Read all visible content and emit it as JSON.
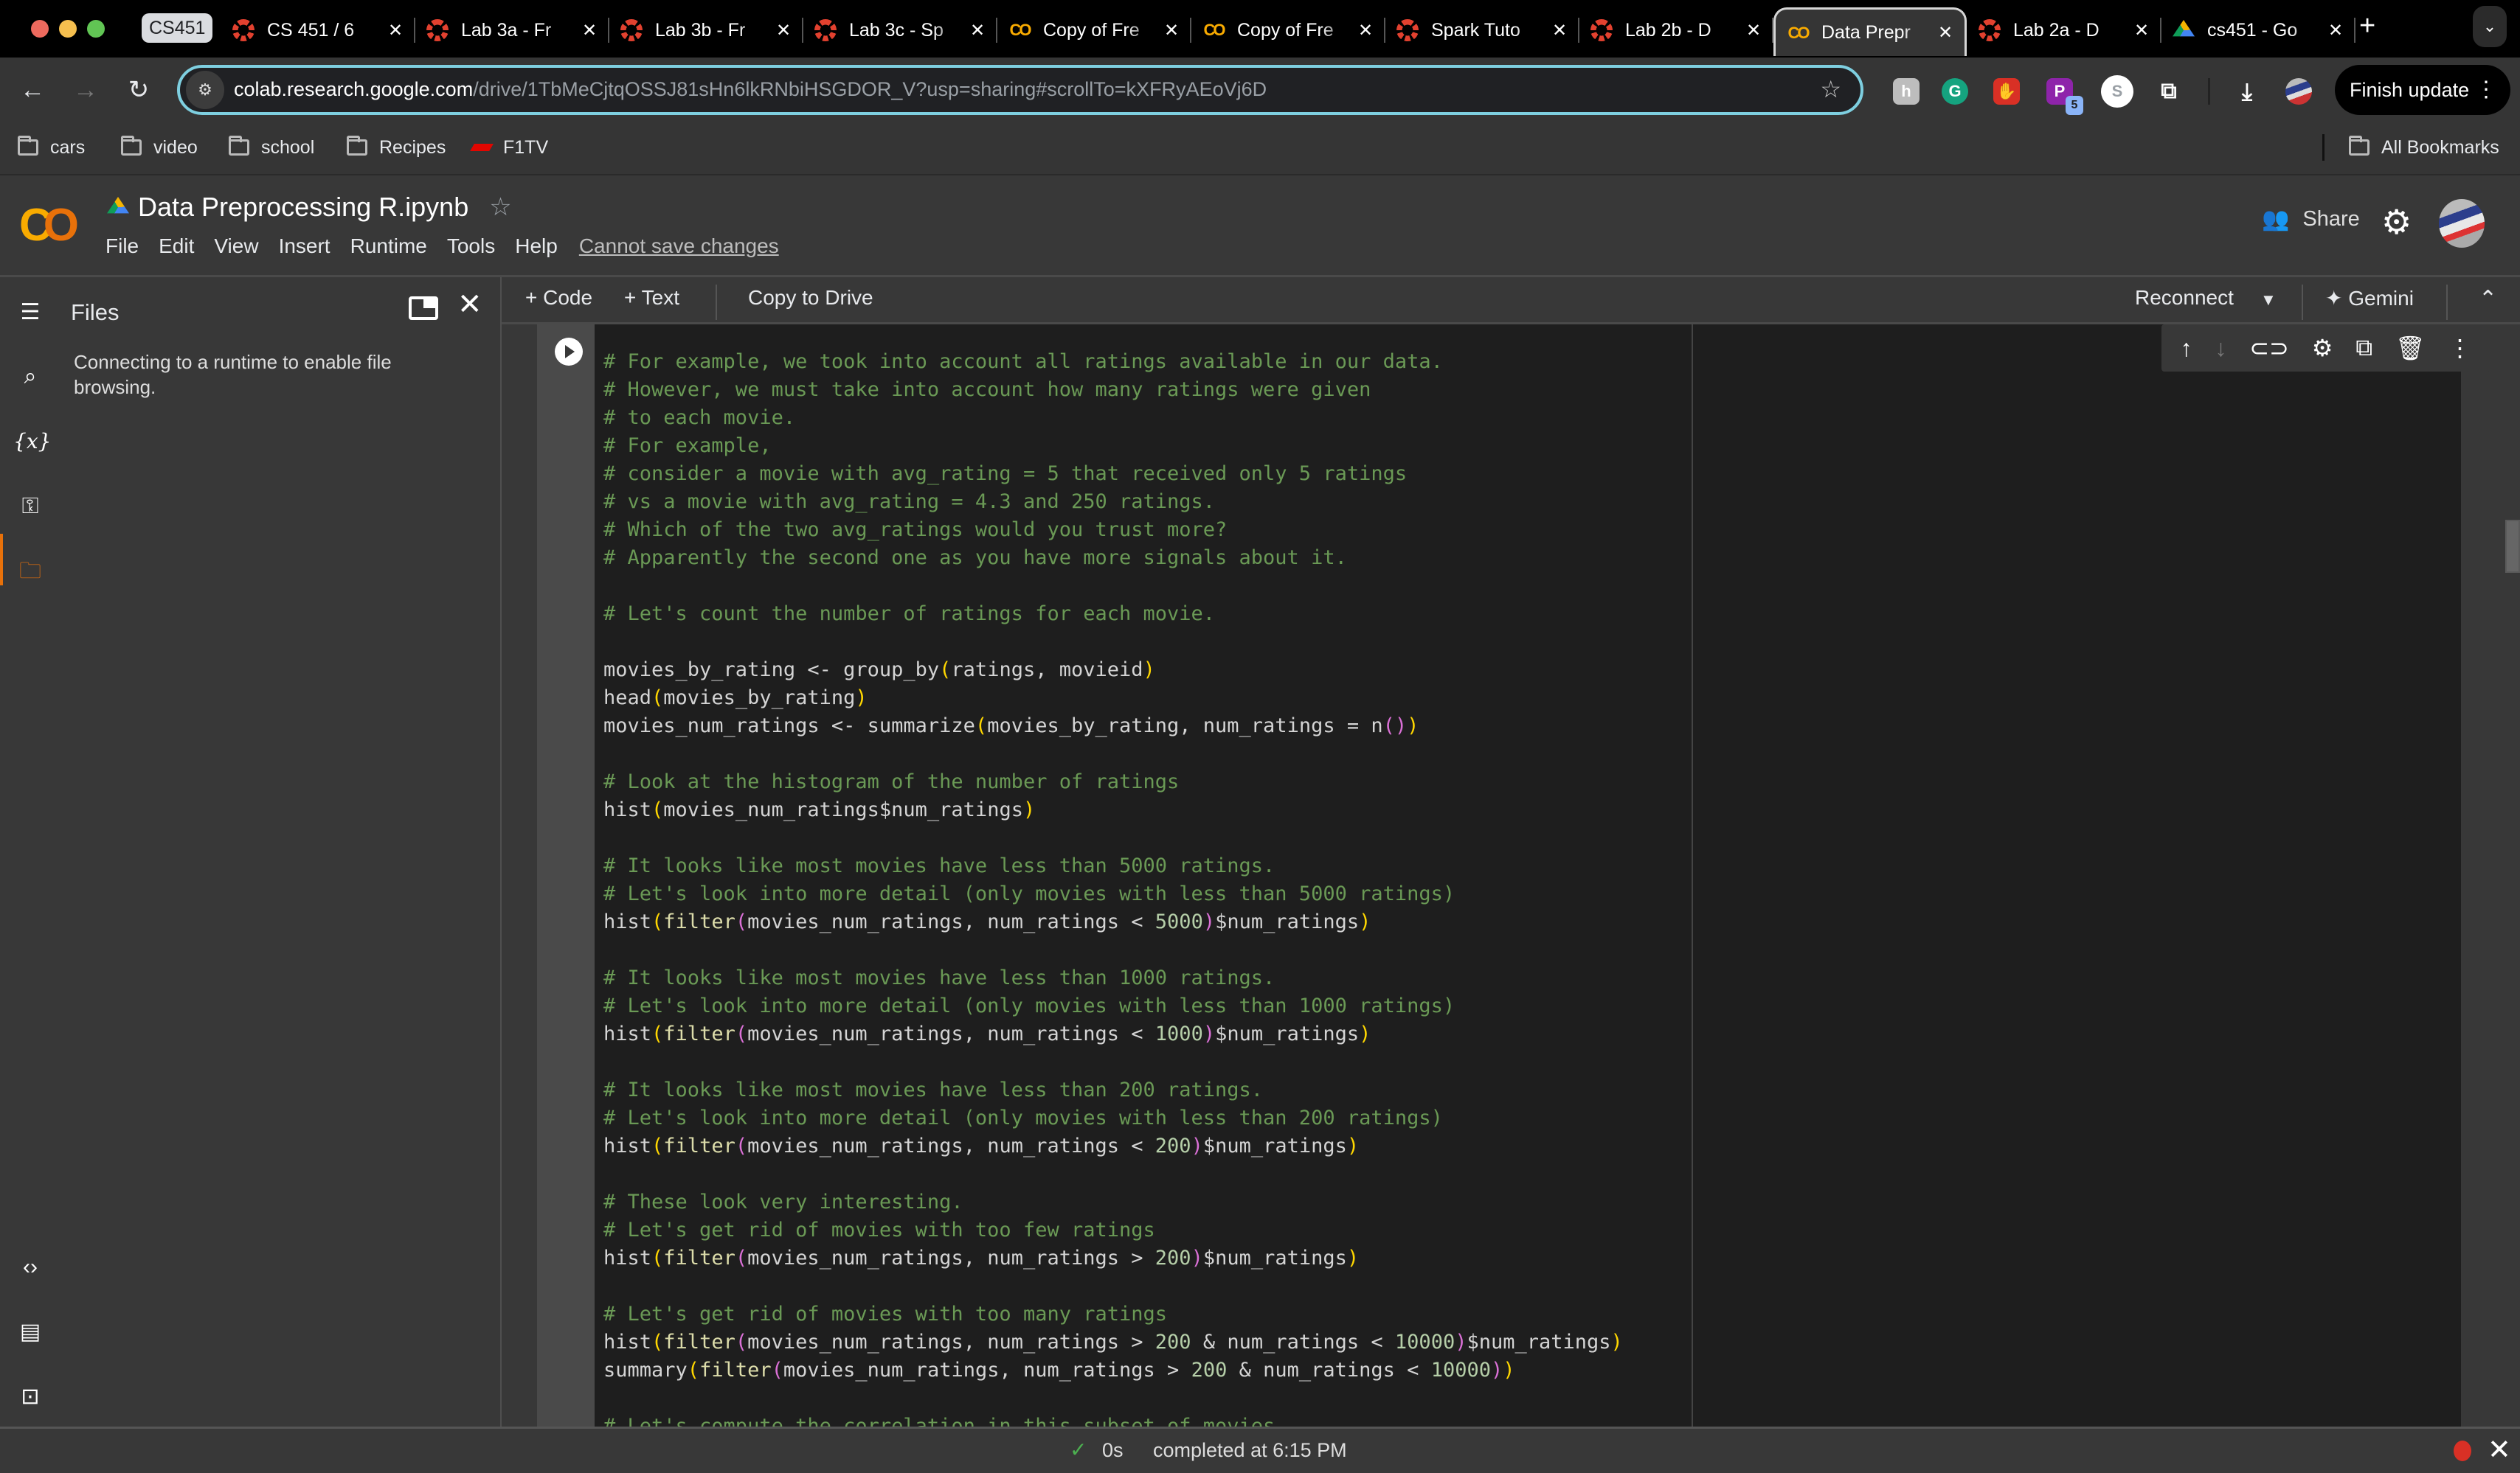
{
  "browser": {
    "tab_group": "CS451",
    "tabs": [
      {
        "title": "CS 451 / 6",
        "favicon": "canvas-icon",
        "active": false
      },
      {
        "title": "Lab 3a - Fr",
        "favicon": "canvas-icon",
        "active": false
      },
      {
        "title": "Lab 3b - Fr",
        "favicon": "canvas-icon",
        "active": false
      },
      {
        "title": "Lab 3c - Sp",
        "favicon": "canvas-icon",
        "active": false
      },
      {
        "title": "Copy of Fre",
        "favicon": "colab-icon",
        "active": false
      },
      {
        "title": "Copy of Fre",
        "favicon": "colab-icon",
        "active": false
      },
      {
        "title": "Spark Tuto",
        "favicon": "canvas-icon",
        "active": false
      },
      {
        "title": "Lab 2b - D",
        "favicon": "canvas-icon",
        "active": false
      },
      {
        "title": "Data Prepr",
        "favicon": "colab-icon",
        "active": true
      },
      {
        "title": "Lab 2a - D",
        "favicon": "canvas-icon",
        "active": false
      },
      {
        "title": "cs451 - Go",
        "favicon": "drive-icon",
        "active": false
      }
    ],
    "url_host": "colab.research.google.com",
    "url_path": "/drive/1TbMeCjtqOSSJ81sHn6lkRNbiHSGDOR_V?usp=sharing#scrollTo=kXFRyAEoVj6D",
    "extensions": [
      {
        "name": "honey-extension",
        "glyph": "h",
        "color": "#bdbdbd"
      },
      {
        "name": "grammarly-extension",
        "glyph": "G",
        "color": "#15a37f"
      },
      {
        "name": "adblock-extension",
        "glyph": "✋",
        "color": "#d93025"
      },
      {
        "name": "p-extension",
        "glyph": "P",
        "color": "#8e24aa",
        "badge": "5"
      },
      {
        "name": "s-extension",
        "glyph": "S",
        "color": "#ffffff"
      }
    ],
    "finish_update": "Finish update",
    "bookmarks": [
      "cars",
      "video",
      "school",
      "Recipes",
      "F1TV"
    ],
    "all_bookmarks": "All Bookmarks"
  },
  "colab": {
    "notebook_title": "Data Preprocessing R.ipynb",
    "menu": [
      "File",
      "Edit",
      "View",
      "Insert",
      "Runtime",
      "Tools",
      "Help"
    ],
    "save_status": "Cannot save changes",
    "share": "Share",
    "toolbar": {
      "add_code": "+ Code",
      "add_text": "+ Text",
      "copy_to_drive": "Copy to Drive",
      "reconnect": "Reconnect",
      "gemini": "Gemini"
    },
    "files_panel": {
      "title": "Files",
      "message": "Connecting to a runtime to enable file browsing."
    },
    "status": {
      "duration": "0s",
      "completed": "completed at 6:15 PM"
    }
  },
  "code_lines": [
    [
      [
        "c",
        "# For example, we took into account all ratings available in our data."
      ]
    ],
    [
      [
        "c",
        "# However, we must take into account how many ratings were given"
      ]
    ],
    [
      [
        "c",
        "# to each movie."
      ]
    ],
    [
      [
        "c",
        "# For example,"
      ]
    ],
    [
      [
        "c",
        "# consider a movie with avg_rating = 5 that received only 5 ratings"
      ]
    ],
    [
      [
        "c",
        "# vs a movie with avg_rating = 4.3 and 250 ratings."
      ]
    ],
    [
      [
        "c",
        "# Which of the two avg_ratings would you trust more?"
      ]
    ],
    [
      [
        "c",
        "# Apparently the second one as you have more signals about it."
      ]
    ],
    [],
    [
      [
        "c",
        "# Let's count the number of ratings for each movie."
      ]
    ],
    [],
    [
      [
        "t",
        "movies_by_rating <- group_by"
      ],
      [
        "p1",
        "("
      ],
      [
        "t",
        "ratings, movieid"
      ],
      [
        "p1",
        ")"
      ]
    ],
    [
      [
        "t",
        "head"
      ],
      [
        "p1",
        "("
      ],
      [
        "t",
        "movies_by_rating"
      ],
      [
        "p1",
        ")"
      ]
    ],
    [
      [
        "t",
        "movies_num_ratings <- summarize"
      ],
      [
        "p1",
        "("
      ],
      [
        "t",
        "movies_by_rating, num_ratings = n"
      ],
      [
        "p2",
        "()"
      ],
      [
        "p1",
        ")"
      ]
    ],
    [],
    [
      [
        "c",
        "# Look at the histogram of the number of ratings"
      ]
    ],
    [
      [
        "t",
        "hist"
      ],
      [
        "p1",
        "("
      ],
      [
        "t",
        "movies_num_ratings$num_ratings"
      ],
      [
        "p1",
        ")"
      ]
    ],
    [],
    [
      [
        "c",
        "# It looks like most movies have less than 5000 ratings."
      ]
    ],
    [
      [
        "c",
        "# Let's look into more detail (only movies with less than 5000 ratings)"
      ]
    ],
    [
      [
        "t",
        "hist"
      ],
      [
        "p1",
        "("
      ],
      [
        "fn",
        "filter"
      ],
      [
        "p2",
        "("
      ],
      [
        "t",
        "movies_num_ratings, num_ratings < "
      ],
      [
        "n",
        "5000"
      ],
      [
        "p2",
        ")"
      ],
      [
        "t",
        "$num_ratings"
      ],
      [
        "p1",
        ")"
      ]
    ],
    [],
    [
      [
        "c",
        "# It looks like most movies have less than 1000 ratings."
      ]
    ],
    [
      [
        "c",
        "# Let's look into more detail (only movies with less than 1000 ratings)"
      ]
    ],
    [
      [
        "t",
        "hist"
      ],
      [
        "p1",
        "("
      ],
      [
        "fn",
        "filter"
      ],
      [
        "p2",
        "("
      ],
      [
        "t",
        "movies_num_ratings, num_ratings < "
      ],
      [
        "n",
        "1000"
      ],
      [
        "p2",
        ")"
      ],
      [
        "t",
        "$num_ratings"
      ],
      [
        "p1",
        ")"
      ]
    ],
    [],
    [
      [
        "c",
        "# It looks like most movies have less than 200 ratings."
      ]
    ],
    [
      [
        "c",
        "# Let's look into more detail (only movies with less than 200 ratings)"
      ]
    ],
    [
      [
        "t",
        "hist"
      ],
      [
        "p1",
        "("
      ],
      [
        "fn",
        "filter"
      ],
      [
        "p2",
        "("
      ],
      [
        "t",
        "movies_num_ratings, num_ratings < "
      ],
      [
        "n",
        "200"
      ],
      [
        "p2",
        ")"
      ],
      [
        "t",
        "$num_ratings"
      ],
      [
        "p1",
        ")"
      ]
    ],
    [],
    [
      [
        "c",
        "# These look very interesting."
      ]
    ],
    [
      [
        "c",
        "# Let's get rid of movies with too few ratings"
      ]
    ],
    [
      [
        "t",
        "hist"
      ],
      [
        "p1",
        "("
      ],
      [
        "fn",
        "filter"
      ],
      [
        "p2",
        "("
      ],
      [
        "t",
        "movies_num_ratings, num_ratings > "
      ],
      [
        "n",
        "200"
      ],
      [
        "p2",
        ")"
      ],
      [
        "t",
        "$num_ratings"
      ],
      [
        "p1",
        ")"
      ]
    ],
    [],
    [
      [
        "c",
        "# Let's get rid of movies with too many ratings"
      ]
    ],
    [
      [
        "t",
        "hist"
      ],
      [
        "p1",
        "("
      ],
      [
        "fn",
        "filter"
      ],
      [
        "p2",
        "("
      ],
      [
        "t",
        "movies_num_ratings, num_ratings > "
      ],
      [
        "n",
        "200"
      ],
      [
        "t",
        " & num_ratings < "
      ],
      [
        "n",
        "10000"
      ],
      [
        "p2",
        ")"
      ],
      [
        "t",
        "$num_ratings"
      ],
      [
        "p1",
        ")"
      ]
    ],
    [
      [
        "t",
        "summary"
      ],
      [
        "p1",
        "("
      ],
      [
        "fn",
        "filter"
      ],
      [
        "p2",
        "("
      ],
      [
        "t",
        "movies_num_ratings, num_ratings > "
      ],
      [
        "n",
        "200"
      ],
      [
        "t",
        " & num_ratings < "
      ],
      [
        "n",
        "10000"
      ],
      [
        "p2",
        ")"
      ],
      [
        "p1",
        ")"
      ]
    ],
    [],
    [
      [
        "c",
        "# Let's compute the correlation in this subset of movies"
      ]
    ]
  ]
}
